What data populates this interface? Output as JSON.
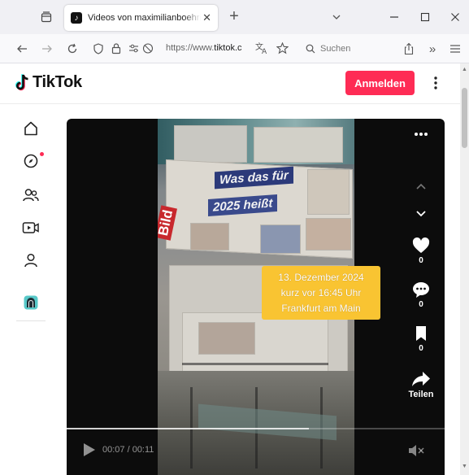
{
  "browser": {
    "tab": {
      "title": "Videos von maximilianboehring",
      "favicon": "tiktok-icon"
    },
    "new_tab_label": "+",
    "url": {
      "prefix": "https://www.",
      "domain": "tiktok.c"
    },
    "search_placeholder": "Suchen",
    "icons": [
      "tab-list-icon",
      "close-tab-icon",
      "chevron-down-icon",
      "minimize-icon",
      "maximize-icon",
      "close-window-icon",
      "back-icon",
      "forward-icon",
      "reload-icon",
      "shield-icon",
      "lock-icon",
      "permissions-icon",
      "translate-icon",
      "star-icon",
      "search-icon",
      "share-icon",
      "overflow-icon",
      "menu-icon"
    ]
  },
  "tiktok": {
    "logo_text": "TikTok",
    "login_label": "Anmelden",
    "brand_color": "#fe2c55",
    "sidebar": [
      "home-icon",
      "explore-icon",
      "following-icon",
      "live-icon",
      "profile-icon",
      "avatar-icon"
    ],
    "video": {
      "caption": {
        "line1": "13. Dezember 2024",
        "line2": "kurz  vor 16:45 Uhr",
        "line3": "Frankfurt am Main"
      },
      "headline_1": "Was das für",
      "headline_2": "2025 heißt",
      "paper_masthead": "Bild",
      "likes": "0",
      "comments": "0",
      "saves": "0",
      "share_label": "Teilen",
      "time": "00:07 / 00:11",
      "progress": 0.64
    }
  }
}
